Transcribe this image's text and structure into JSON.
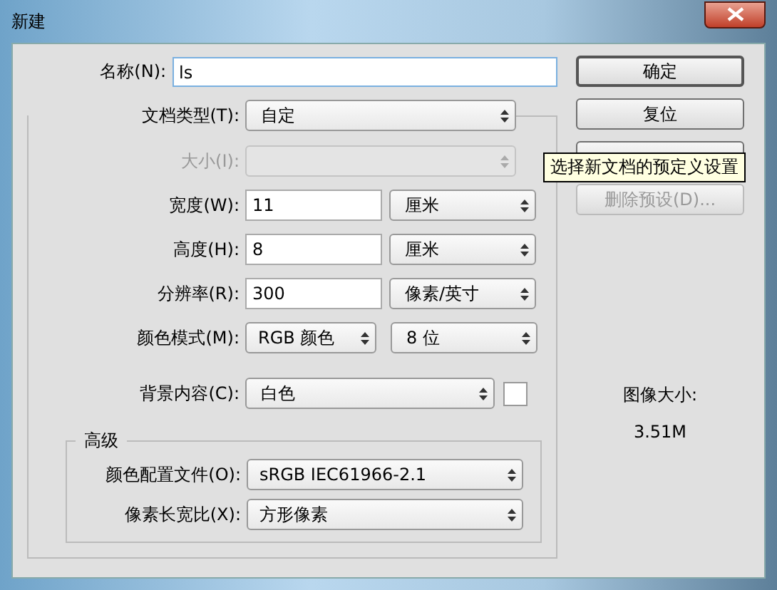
{
  "window": {
    "title": "新建"
  },
  "name_field": {
    "label": "名称(N):",
    "value": "ls"
  },
  "preset": {
    "label": "文档类型(T):",
    "value": "自定"
  },
  "size": {
    "label": "大小(I):",
    "disabled": true
  },
  "dims": [
    {
      "label": "宽度(W):",
      "value": "11",
      "unit": "厘米"
    },
    {
      "label": "高度(H):",
      "value": "8",
      "unit": "厘米"
    },
    {
      "label": "分辨率(R):",
      "value": "300",
      "unit": "像素/英寸"
    }
  ],
  "color_mode": {
    "label": "颜色模式(M):",
    "mode": "RGB 颜色",
    "depth": "8 位"
  },
  "background": {
    "label": "背景内容(C):",
    "value": "白色"
  },
  "advanced": {
    "title": "高级",
    "rows": [
      {
        "label": "颜色配置文件(O):",
        "value": "sRGB IEC61966-2.1"
      },
      {
        "label": "像素长宽比(X):",
        "value": "方形像素"
      }
    ]
  },
  "buttons": [
    {
      "label": "确定",
      "default": true,
      "disabled": false
    },
    {
      "label": "复位",
      "default": false,
      "disabled": false
    },
    {
      "default": false,
      "disabled": false
    },
    {
      "label": "删除预设(D)...",
      "default": false,
      "disabled": true
    }
  ],
  "tooltip": {
    "text": "选择新文档的预定义设置"
  },
  "image_size": {
    "label": "图像大小:",
    "value": "3.51M"
  }
}
